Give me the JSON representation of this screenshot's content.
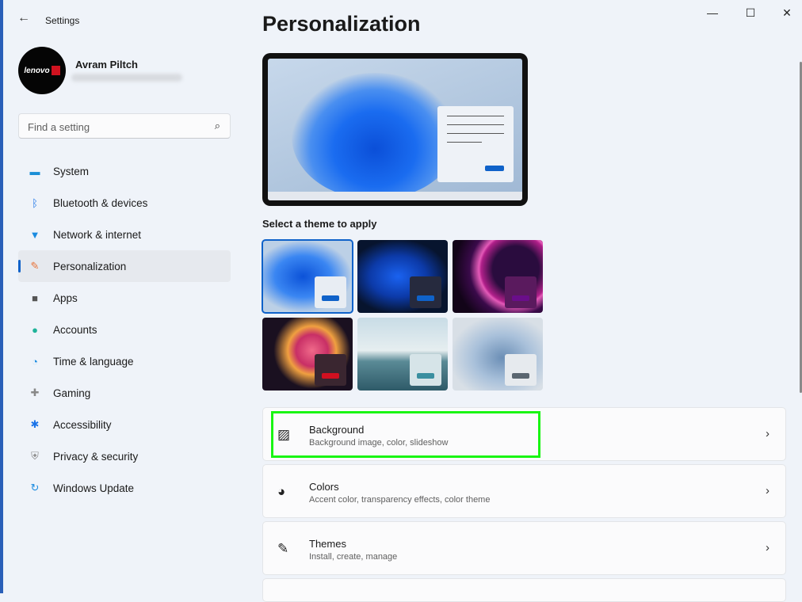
{
  "window": {
    "title": "Settings",
    "controls": [
      "minimize",
      "maximize",
      "close"
    ]
  },
  "user": {
    "name": "Avram Piltch",
    "avatar_text": "lenovo"
  },
  "search": {
    "placeholder": "Find a setting"
  },
  "nav": [
    {
      "label": "System",
      "icon": "monitor-icon",
      "color": "#1b8fd6"
    },
    {
      "label": "Bluetooth & devices",
      "icon": "bluetooth-icon",
      "color": "#1a73e8"
    },
    {
      "label": "Network & internet",
      "icon": "wifi-icon",
      "color": "#1a8be0"
    },
    {
      "label": "Personalization",
      "icon": "brush-icon",
      "color": "#e8743a",
      "selected": true
    },
    {
      "label": "Apps",
      "icon": "apps-icon",
      "color": "#555"
    },
    {
      "label": "Accounts",
      "icon": "person-icon",
      "color": "#1fb39a"
    },
    {
      "label": "Time & language",
      "icon": "clock-globe-icon",
      "color": "#1a8be0"
    },
    {
      "label": "Gaming",
      "icon": "gamepad-icon",
      "color": "#888"
    },
    {
      "label": "Accessibility",
      "icon": "accessibility-icon",
      "color": "#1a73e8"
    },
    {
      "label": "Privacy & security",
      "icon": "shield-icon",
      "color": "#888"
    },
    {
      "label": "Windows Update",
      "icon": "update-icon",
      "color": "#1a8be0"
    }
  ],
  "page": {
    "title": "Personalization",
    "theme_label": "Select a theme to apply"
  },
  "themes": [
    {
      "name": "windows-light",
      "selected": true
    },
    {
      "name": "windows-dark"
    },
    {
      "name": "glow"
    },
    {
      "name": "captured-motion"
    },
    {
      "name": "sunrise"
    },
    {
      "name": "flow"
    }
  ],
  "cards": [
    {
      "title": "Background",
      "subtitle": "Background image, color, slideshow",
      "icon": "image-icon",
      "highlighted": true
    },
    {
      "title": "Colors",
      "subtitle": "Accent color, transparency effects, color theme",
      "icon": "palette-icon"
    },
    {
      "title": "Themes",
      "subtitle": "Install, create, manage",
      "icon": "brush-icon"
    }
  ],
  "colors": {
    "accent": "#0f62c9",
    "highlight": "#19f513"
  }
}
